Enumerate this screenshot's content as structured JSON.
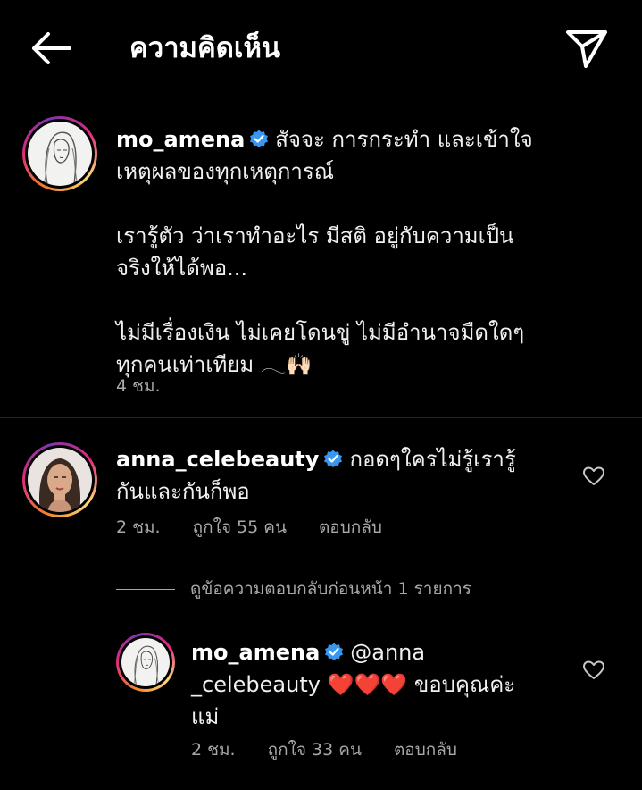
{
  "header": {
    "title": "ความคิดเห็น",
    "back_icon": "arrow-left-icon",
    "send_icon": "paper-plane-icon"
  },
  "caption": {
    "username": "mo_amena",
    "text_1": "สัจจะ การกระทำ และเข้าใจ",
    "text_2": "เหตุผลของทุกเหตุการณ์",
    "text_3": "เรารู้ตัว ว่าเราทำอะไร มีสติ อยู่กับความเป็น",
    "text_4": "จริงให้ได้พอ...",
    "text_5": "ไม่มีเรื่องเงิน ไม่เคยโดนขู่ ไม่มีอำนาจมืดใดๆ",
    "text_6": "ทุกคนเท่าเทียม 𓂃🙌🏻",
    "time": "4 ชม."
  },
  "comment": {
    "username": "anna_celebeauty",
    "text_1": "กอดๆใครไม่รู้เรารู้",
    "text_2": "กันและกันก็พอ",
    "time": "2 ชม.",
    "likes": "ถูกใจ 55 คน",
    "reply": "ตอบกลับ"
  },
  "view_previous_replies": "ดูข้อความตอบกลับก่อนหน้า 1 รายการ",
  "reply": {
    "username": "mo_amena",
    "text_1": "@anna",
    "text_2": "_celebeauty",
    "hearts": "❤️❤️❤️",
    "text_3": "ขอบคุณค่ะ",
    "text_4": "แม่",
    "time": "2 ชม.",
    "likes": "ถูกใจ 33 คน",
    "reply": "ตอบกลับ"
  },
  "colors": {
    "background": "#000000",
    "text": "#f5f5f5",
    "secondary": "#a8a8a8",
    "verified": "#3897f0",
    "heart": "#e0245e"
  }
}
